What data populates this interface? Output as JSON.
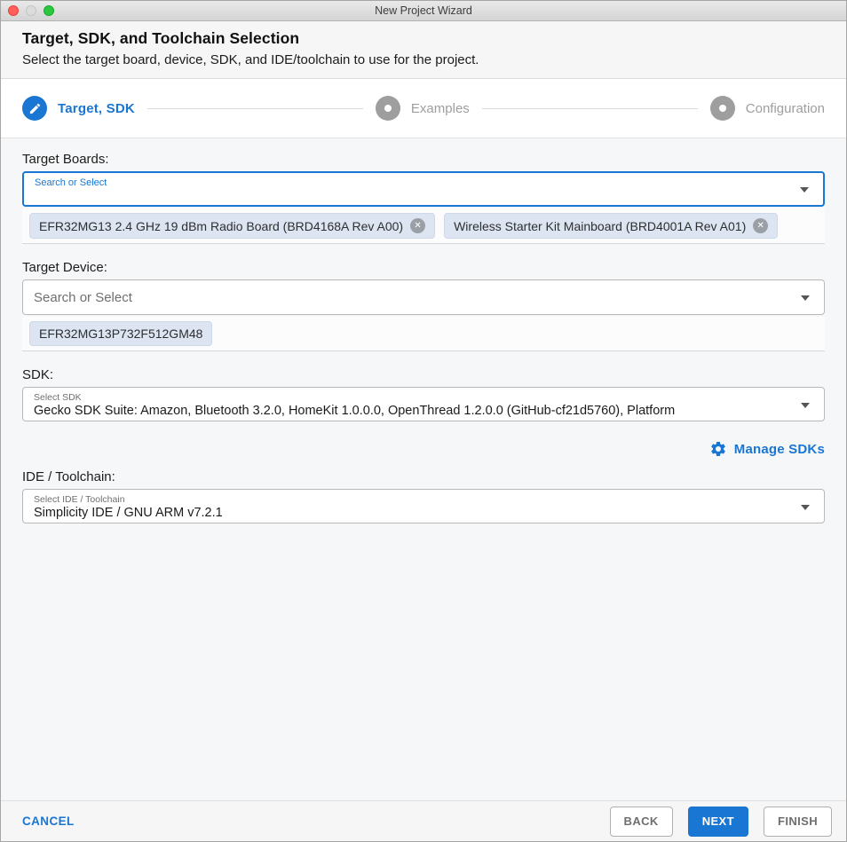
{
  "window": {
    "title": "New Project Wizard"
  },
  "header": {
    "title": "Target, SDK, and Toolchain Selection",
    "subtitle": "Select the target board, device, SDK, and IDE/toolchain to use for the project."
  },
  "stepper": {
    "steps": [
      {
        "label": "Target, SDK",
        "state": "active",
        "icon": "pencil-icon"
      },
      {
        "label": "Examples",
        "state": "inactive",
        "icon": "dot-icon"
      },
      {
        "label": "Configuration",
        "state": "inactive",
        "icon": "dot-icon"
      }
    ]
  },
  "form": {
    "target_boards": {
      "label": "Target Boards:",
      "placeholder": "Search or Select",
      "chips": [
        {
          "text": "EFR32MG13 2.4 GHz 19 dBm Radio Board (BRD4168A Rev A00)",
          "removable": true
        },
        {
          "text": "Wireless Starter Kit Mainboard (BRD4001A Rev A01)",
          "removable": true
        }
      ]
    },
    "target_device": {
      "label": "Target Device:",
      "placeholder": "Search or Select",
      "chips": [
        {
          "text": "EFR32MG13P732F512GM48",
          "removable": false
        }
      ]
    },
    "sdk": {
      "label": "SDK:",
      "select_label": "Select SDK",
      "value": "Gecko SDK Suite: Amazon, Bluetooth 3.2.0, HomeKit 1.0.0.0, OpenThread 1.2.0.0 (GitHub-cf21d5760), Platform",
      "manage_label": "Manage SDKs"
    },
    "ide_toolchain": {
      "label": "IDE / Toolchain:",
      "select_label": "Select IDE / Toolchain",
      "value": "Simplicity IDE / GNU ARM v7.2.1"
    }
  },
  "footer": {
    "cancel_label": "CANCEL",
    "back_label": "BACK",
    "next_label": "NEXT",
    "finish_label": "FINISH"
  },
  "icons": {
    "chip_remove": "✕",
    "dropdown_arrow": "▾",
    "step_active": "pencil",
    "manage": "gear"
  },
  "colors": {
    "accent": "#1976d2",
    "inactive_step": "#9e9e9e",
    "chip_bg": "#dce5f1",
    "traffic_red": "#ff5f57",
    "traffic_green": "#29c83f"
  }
}
